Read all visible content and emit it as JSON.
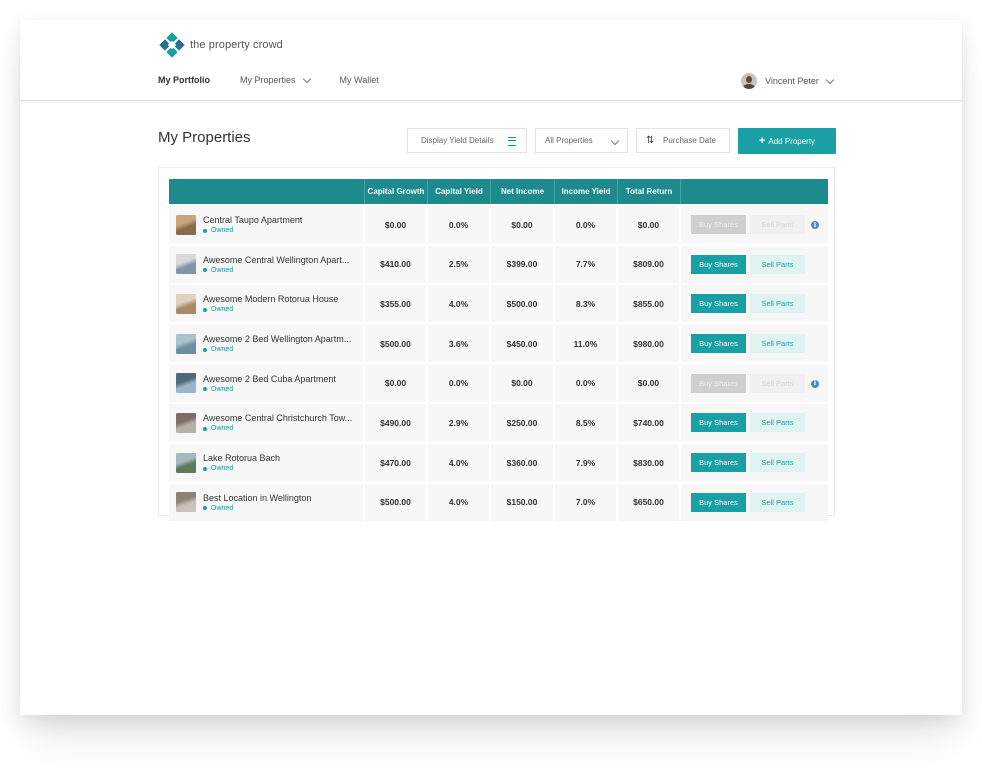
{
  "brand": {
    "name": "the property crowd"
  },
  "nav": {
    "portfolio": "My Portfolio",
    "properties": "My Properties",
    "wallet": "My Wallet"
  },
  "user": {
    "name": "Vincent Peter"
  },
  "page": {
    "title": "My Properties"
  },
  "controls": {
    "yield_toggle": "Display Yield Details",
    "filter": "All Properties",
    "sort": "Purchase Date",
    "add_button": "Add Property"
  },
  "table": {
    "columns": [
      "",
      "Capital Growth",
      "Capital Yield",
      "Net Income",
      "Income Yield",
      "Total Return",
      ""
    ],
    "buy_label": "Buy Shares",
    "sell_label": "Sell Parts",
    "rows": [
      {
        "name": "Central Taupo Apartment",
        "status": "Owned",
        "capital_growth": "$0.00",
        "capital_yield": "0.0%",
        "net_income": "$0.00",
        "income_yield": "0.0%",
        "total_return": "$0.00",
        "actions_enabled": false,
        "info": true,
        "thumb": "thumb-a"
      },
      {
        "name": "Awesome Central Wellington Apart...",
        "status": "Owned",
        "capital_growth": "$410.00",
        "capital_yield": "2.5%",
        "net_income": "$399.00",
        "income_yield": "7.7%",
        "total_return": "$809.00",
        "actions_enabled": true,
        "info": false,
        "thumb": "thumb-b"
      },
      {
        "name": "Awesome Modern Rotorua House",
        "status": "Owned",
        "capital_growth": "$355.00",
        "capital_yield": "4.0%",
        "net_income": "$500.00",
        "income_yield": "8.3%",
        "total_return": "$855.00",
        "actions_enabled": true,
        "info": false,
        "thumb": "thumb-c"
      },
      {
        "name": "Awesome 2 Bed Wellington Apartm...",
        "status": "Owned",
        "capital_growth": "$500.00",
        "capital_yield": "3.6%",
        "net_income": "$450.00",
        "income_yield": "11.0%",
        "total_return": "$980.00",
        "actions_enabled": true,
        "info": false,
        "thumb": "thumb-d"
      },
      {
        "name": "Awesome 2 Bed Cuba Apartment",
        "status": "Owned",
        "capital_growth": "$0.00",
        "capital_yield": "0.0%",
        "net_income": "$0.00",
        "income_yield": "0.0%",
        "total_return": "$0.00",
        "actions_enabled": false,
        "info": true,
        "thumb": "thumb-e"
      },
      {
        "name": "Awesome Central Christchurch Tow...",
        "status": "Owned",
        "capital_growth": "$490.00",
        "capital_yield": "2.9%",
        "net_income": "$250.00",
        "income_yield": "8.5%",
        "total_return": "$740.00",
        "actions_enabled": true,
        "info": false,
        "thumb": "thumb-f"
      },
      {
        "name": "Lake Rotorua Bach",
        "status": "Owned",
        "capital_growth": "$470.00",
        "capital_yield": "4.0%",
        "net_income": "$360.00",
        "income_yield": "7.9%",
        "total_return": "$830.00",
        "actions_enabled": true,
        "info": false,
        "thumb": "thumb-g"
      },
      {
        "name": "Best Location in Wellington",
        "status": "Owned",
        "capital_growth": "$500.00",
        "capital_yield": "4.0%",
        "net_income": "$150.00",
        "income_yield": "7.0%",
        "total_return": "$650.00",
        "actions_enabled": true,
        "info": false,
        "thumb": "thumb-h"
      }
    ]
  },
  "thumb_colors": {
    "thumb-a": [
      "#8a6b4e",
      "#c9a57c"
    ],
    "thumb-b": [
      "#7f95a8",
      "#d9d9d9"
    ],
    "thumb-c": [
      "#a7896b",
      "#e0d2c0"
    ],
    "thumb-d": [
      "#6f8ca0",
      "#a9c4cf"
    ],
    "thumb-e": [
      "#9cb5c9",
      "#4d6b7a"
    ],
    "thumb-f": [
      "#b7b0a6",
      "#7d6e63"
    ],
    "thumb-g": [
      "#5e7a5a",
      "#a9b8bf"
    ],
    "thumb-h": [
      "#c9c2b8",
      "#8e8277"
    ]
  },
  "colors": {
    "accent": "#19a0a5",
    "header_bg": "#1d8a8d",
    "status": "#14999b",
    "info": "#5f84b8"
  },
  "icons": [
    "logo-icon",
    "chevron-down-icon",
    "hamburger-icon",
    "sort-icon",
    "plus-icon",
    "info-icon"
  ]
}
